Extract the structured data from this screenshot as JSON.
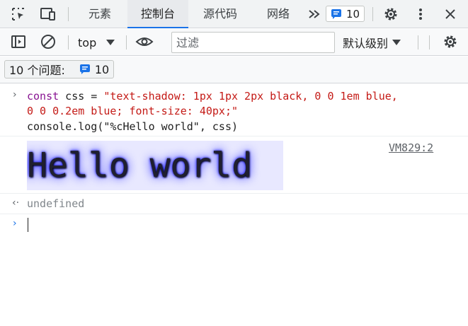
{
  "tabs": {
    "elements": "元素",
    "console": "控制台",
    "sources": "源代码",
    "network": "网络",
    "issues_count": "10"
  },
  "toolbar": {
    "context": "top",
    "filter_placeholder": "过滤",
    "levels": "默认级别"
  },
  "issues_bar": {
    "label": "10 个问题:",
    "count": "10"
  },
  "console": {
    "input_line1_kw": "const",
    "input_line1_var": " css = ",
    "input_line1_str": "\"text-shadow: 1px 1px 2px black, 0 0 1em blue,",
    "input_line2_str": "0 0 0.2em blue; font-size: 40px;\"",
    "input_line3": "console.log(\"%cHello world\", css)",
    "output_text": "Hello world",
    "source_link": "VM829:2",
    "return_value": "undefined"
  },
  "colors": {
    "accent": "#1a73e8",
    "keyword": "#881391",
    "string": "#c41a16",
    "hello_bg": "#e8e8ff"
  }
}
